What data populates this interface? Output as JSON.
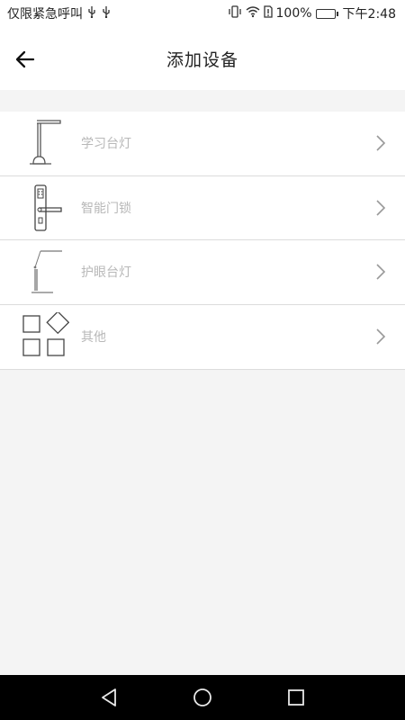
{
  "status_bar": {
    "carrier_text": "仅限紧急呼叫",
    "battery_text": "100%",
    "time": "下午2:48",
    "battery_level": 1.0,
    "colors": {
      "battery_fill": "#2fbf4a"
    }
  },
  "header": {
    "title": "添加设备",
    "back_icon": "arrow-left-icon"
  },
  "devices": [
    {
      "label": "学习台灯",
      "icon": "desk-lamp-icon"
    },
    {
      "label": "智能门锁",
      "icon": "smart-lock-icon"
    },
    {
      "label": "护眼台灯",
      "icon": "eye-care-lamp-icon"
    },
    {
      "label": "其他",
      "icon": "other-grid-icon"
    }
  ],
  "nav_bar": {
    "back": "triangle-back-icon",
    "home": "circle-home-icon",
    "recent": "square-recent-icon"
  }
}
